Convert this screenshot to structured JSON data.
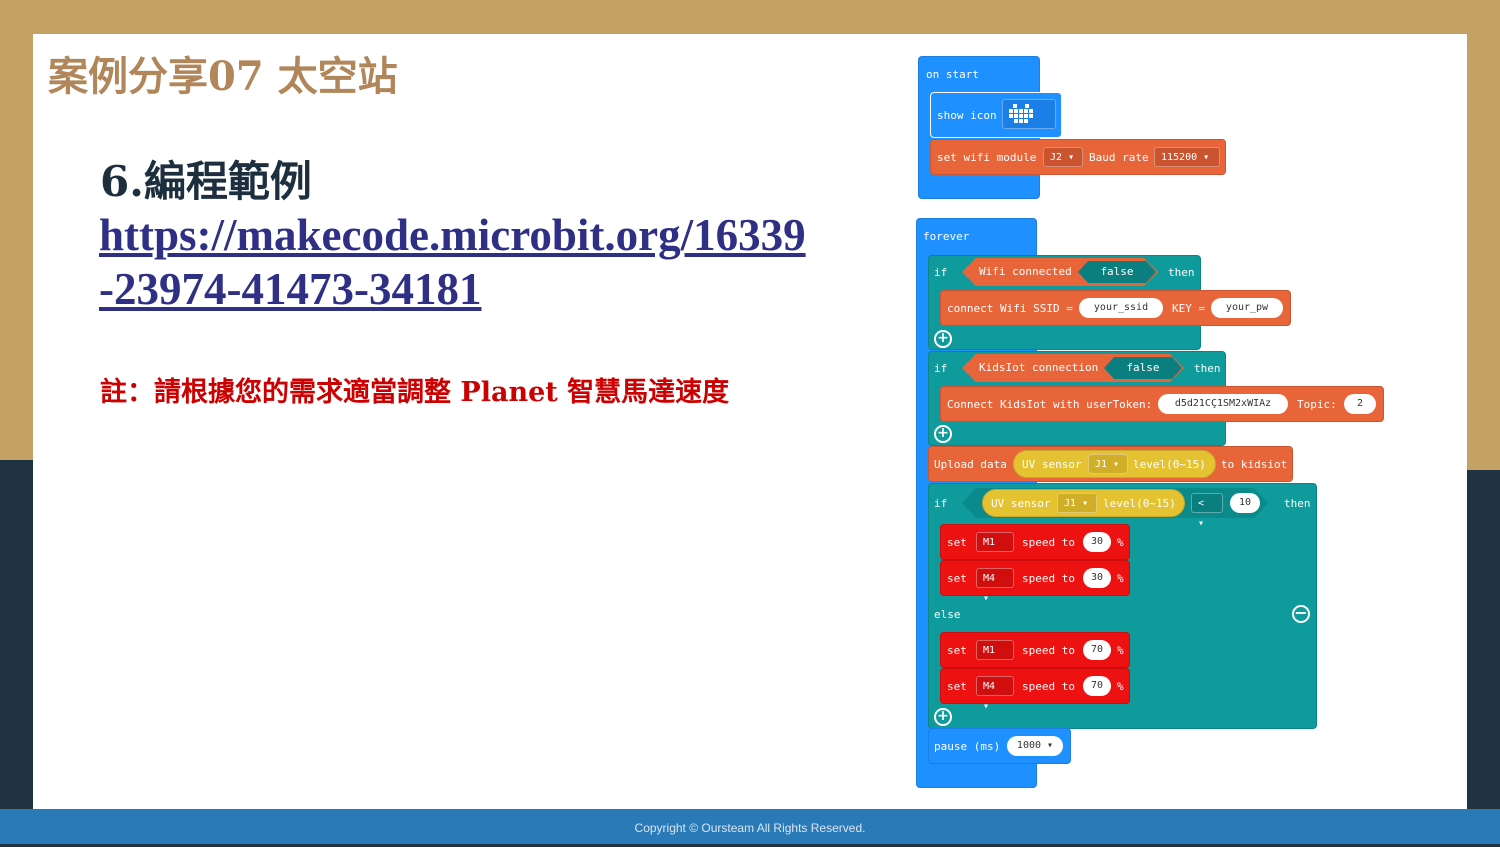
{
  "slide": {
    "title": "案例分享07 太空站",
    "heading": "6.編程範例",
    "link": "https://makecode.microbit.org/16339-23974-41473-34181",
    "note": "註：請根據您的需求適當調整  Planet 智慧馬達速度",
    "footer": "Copyright © Oursteam All Rights Reserved."
  },
  "colors": {
    "title": "#b0865a",
    "link": "#2f2f85",
    "note": "#cc0000",
    "block_blue": "#1e90ff",
    "block_orange": "#e8653a",
    "block_teal": "#0f9b9b",
    "block_yellow": "#e4c232",
    "block_red": "#ee1111"
  },
  "blocks": {
    "on_start": "on start",
    "show_icon": "show icon",
    "icon_name": "heart-icon",
    "set_wifi": "set wifi module",
    "wifi_port": "J2",
    "baud_label": "Baud rate",
    "baud_value": "115200",
    "forever": "forever",
    "if1": "if",
    "wifi_connected": "Wifi connected",
    "false1": "false",
    "then1": "then",
    "connect_wifi": "connect Wifi SSID =",
    "ssid": "your_ssid",
    "key_label": "KEY =",
    "pw": "your_pw",
    "if2": "if",
    "kidsiot_conn": "KidsIot connection",
    "false2": "false",
    "then2": "then",
    "connect_kidsiot": "Connect KidsIot with userToken:",
    "token": "d5d21CÇ1SM2xWIAz",
    "topic_label": "Topic:",
    "topic": "2",
    "upload": "Upload data",
    "uv1": "UV sensor",
    "uv1_port": "J1",
    "uv1_level": "level(0~15)",
    "to_kidsiot": "to kidsiot",
    "if3": "if",
    "uv2": "UV sensor",
    "uv2_port": "J1",
    "uv2_level": "level(0~15)",
    "cmp": "<",
    "threshold": "10",
    "then3": "then",
    "set": "set",
    "m1": "M1",
    "m4": "M4",
    "speed_to": "speed to",
    "speed_low": "30",
    "speed_high": "70",
    "percent": "%",
    "else": "else",
    "pause": "pause (ms)",
    "pause_val": "1000"
  }
}
